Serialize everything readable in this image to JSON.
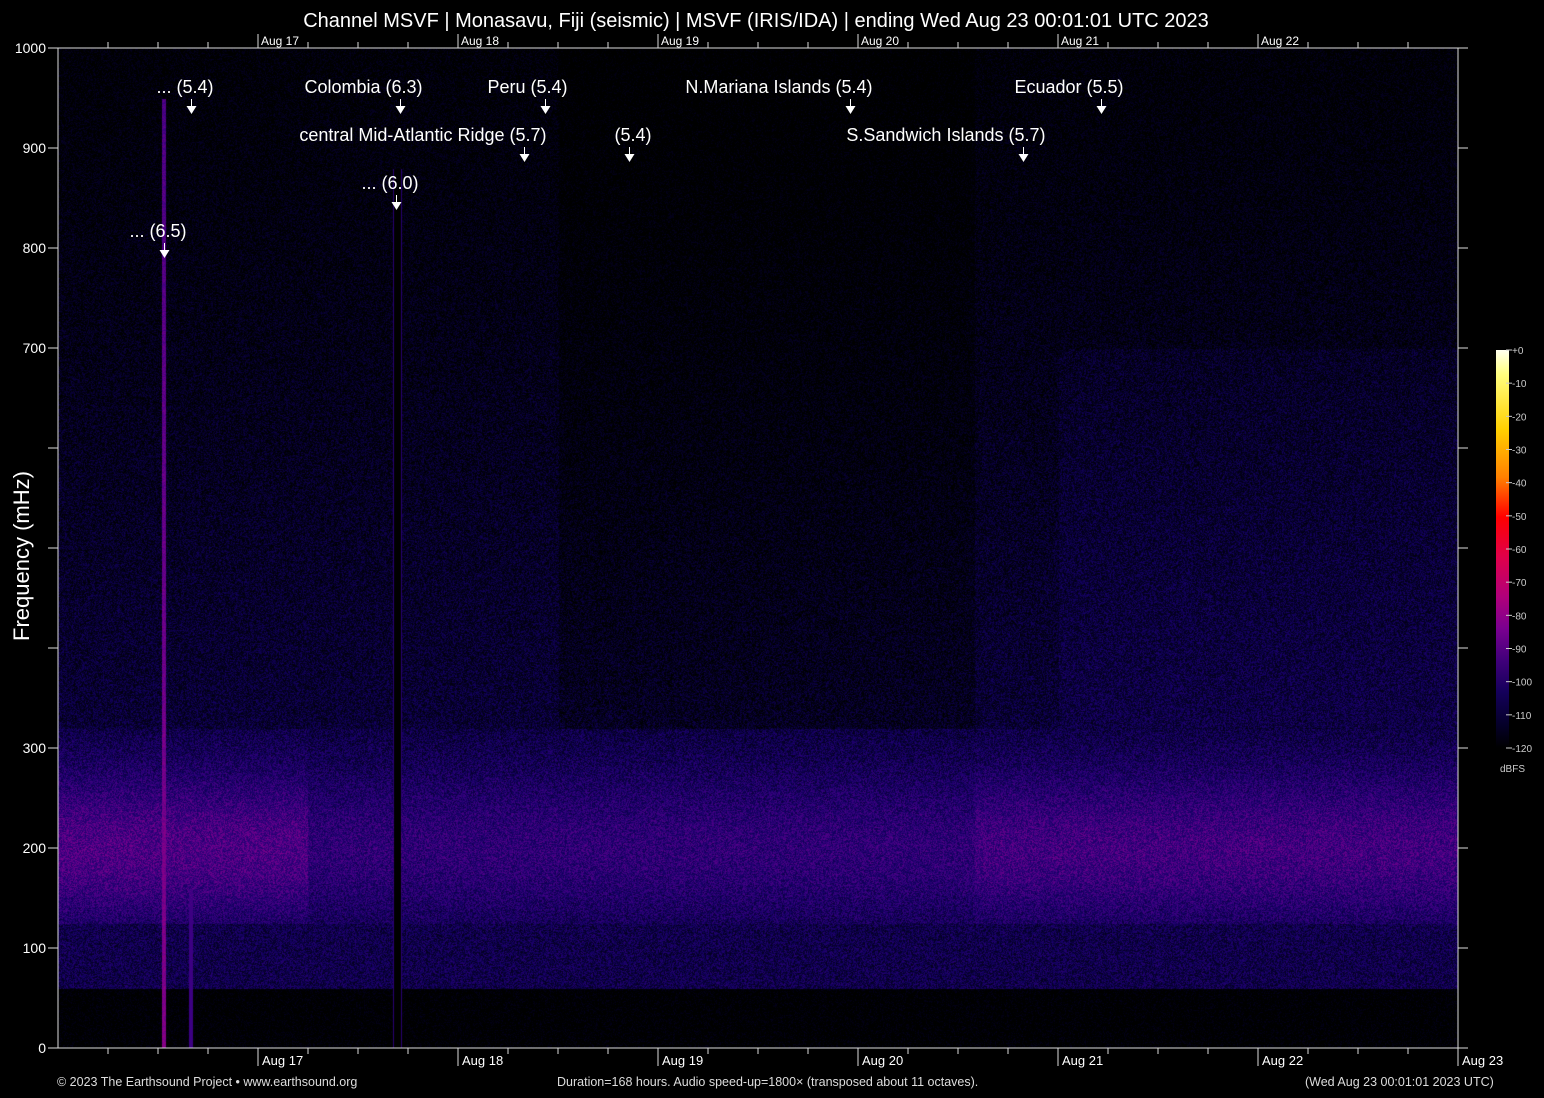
{
  "title": "Channel MSVF | Monasavu, Fiji (seismic) | MSVF (IRIS/IDA) | ending Wed Aug 23 00:01:01 UTC 2023",
  "footer": {
    "left": "© 2023 The Earthsound Project • www.earthsound.org",
    "center": "Duration=168 hours. Audio speed-up=1800× (transposed about 11 octaves).",
    "right": "(Wed Aug 23 00:01:01 2023 UTC)"
  },
  "chart_data": {
    "type": "heatmap",
    "title": "Channel MSVF | Monasavu, Fiji (seismic) | MSVF (IRIS/IDA) | ending Wed Aug 23 00:01:01 UTC 2023",
    "xlabel": "",
    "ylabel": "Frequency (mHz)",
    "duration_hours": 168,
    "xlim_hours": [
      0,
      168
    ],
    "ylim": [
      0,
      1000
    ],
    "y_ticks": [
      0,
      100,
      200,
      300,
      400,
      500,
      600,
      700,
      800,
      900,
      1000
    ],
    "y_tick_labels": [
      "0",
      "100",
      "200",
      "300",
      "",
      "",
      "",
      "700",
      "800",
      "900",
      "1000"
    ],
    "x_day_ticks": [
      {
        "label": "Aug 17",
        "hour": 24
      },
      {
        "label": "Aug 18",
        "hour": 48
      },
      {
        "label": "Aug 19",
        "hour": 72
      },
      {
        "label": "Aug 20",
        "hour": 96
      },
      {
        "label": "Aug 21",
        "hour": 120
      },
      {
        "label": "Aug 22",
        "hour": 144
      }
    ],
    "x_end_label": "Aug 23",
    "x_minor_tick_hours": 6,
    "colorbar": {
      "label": "dBFS",
      "ticks": [
        "+0",
        "-10",
        "-20",
        "-30",
        "-40",
        "-50",
        "-60",
        "-70",
        "-80",
        "-90",
        "-100",
        "-110",
        "-120"
      ],
      "range": [
        -120,
        0
      ]
    },
    "events": [
      {
        "label": "... (6.5)",
        "hour": 12.7,
        "row": 4
      },
      {
        "label": "... (5.4)",
        "hour": 16.0,
        "row": 1
      },
      {
        "label": "Colombia (6.3)",
        "hour": 41.0,
        "row": 1
      },
      {
        "label": "... (6.0)",
        "hour": 40.6,
        "row": 3
      },
      {
        "label": "central Mid-Atlantic Ridge (5.7)",
        "hour": 55.9,
        "row": 2
      },
      {
        "label": "Peru (5.4)",
        "hour": 58.4,
        "row": 1
      },
      {
        "label": "(5.4)",
        "hour": 68.5,
        "row": 2
      },
      {
        "label": "N.Mariana Islands (5.4)",
        "hour": 95.0,
        "row": 1
      },
      {
        "label": "S.Sandwich Islands (5.7)",
        "hour": 115.8,
        "row": 2
      },
      {
        "label": "Ecuador (5.5)",
        "hour": 125.2,
        "row": 1
      }
    ]
  }
}
